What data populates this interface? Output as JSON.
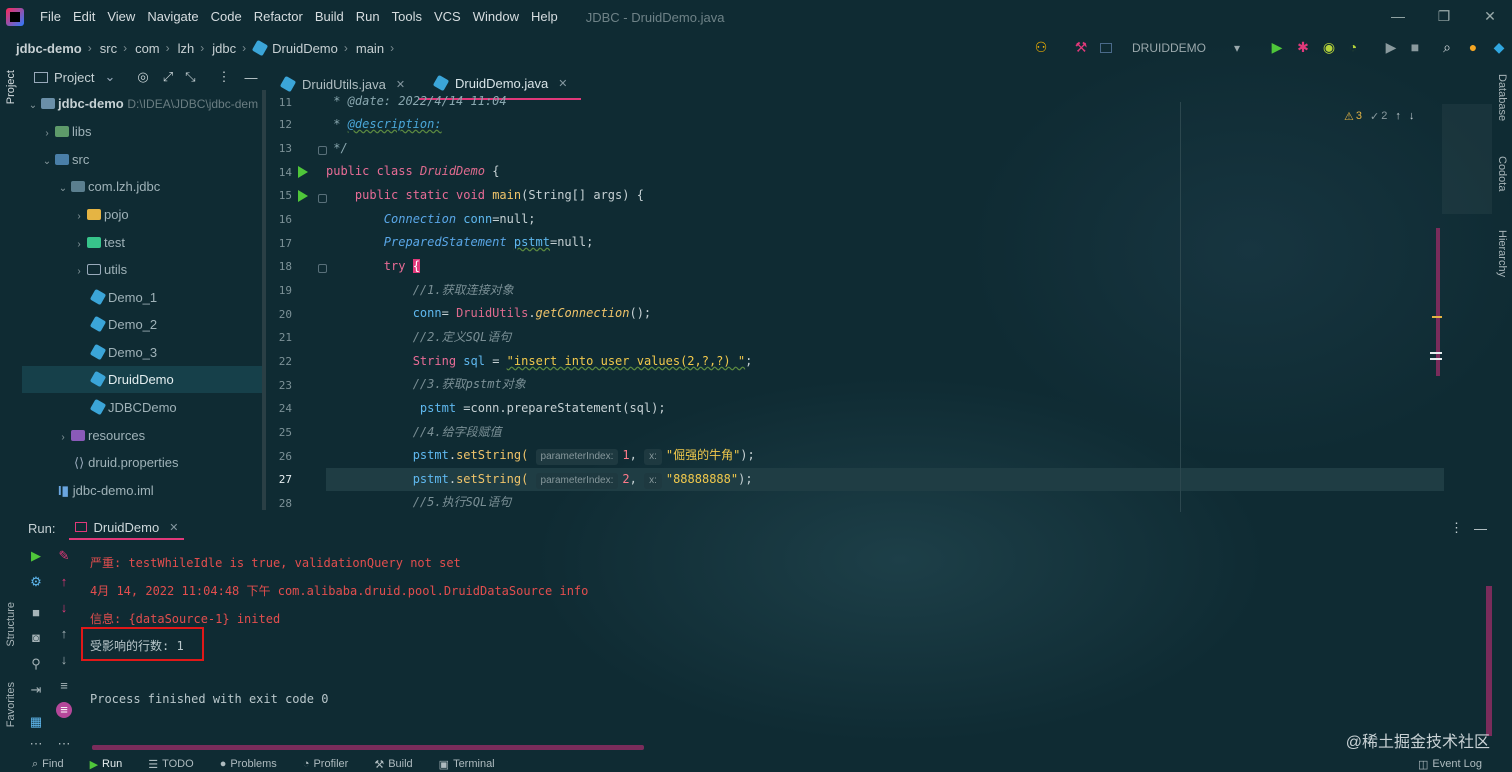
{
  "menu": [
    "File",
    "Edit",
    "View",
    "Navigate",
    "Code",
    "Refactor",
    "Build",
    "Run",
    "Tools",
    "VCS",
    "Window",
    "Help"
  ],
  "window_title": "JDBC - DruidDemo.java",
  "breadcrumb": [
    "jdbc-demo",
    "src",
    "com",
    "lzh",
    "jdbc",
    "DruidDemo",
    "main"
  ],
  "run_config": "DRUIDDEMO",
  "project_panel": {
    "title": "Project",
    "root_name": "jdbc-demo",
    "root_path": "D:\\IDEA\\JDBC\\jdbc-dem",
    "items": [
      "libs",
      "src",
      "com.lzh.jdbc",
      "pojo",
      "test",
      "utils",
      "Demo_1",
      "Demo_2",
      "Demo_3",
      "DruidDemo",
      "JDBCDemo",
      "resources",
      "druid.properties",
      "jdbc-demo.iml"
    ]
  },
  "editor": {
    "tabs": [
      "DruidUtils.java",
      "DruidDemo.java"
    ],
    "active_tab": "DruidDemo.java",
    "line_numbers": [
      "11",
      "12",
      "13",
      "14",
      "15",
      "16",
      "17",
      "18",
      "19",
      "20",
      "21",
      "22",
      "23",
      "24",
      "25",
      "26",
      "27",
      "28"
    ],
    "current_line": "27",
    "code": {
      "l11": " * @date: 2022/4/14 11:04",
      "l12_tag": "@description:",
      "l13": " */",
      "l14_kw": "public class",
      "l14_cls": "DruidDemo",
      "l15_kw": "public static void",
      "l15_fn": "main",
      "l15_rest": "(String[] args) {",
      "l16_ty": "Connection",
      "l16_var": "conn",
      "l16_rest": "=null;",
      "l17_ty": "PreparedStatement",
      "l17_var": "pstmt",
      "l17_rest": "=null;",
      "l18_kw": "try",
      "l19": "//1.获取连接对象",
      "l20_var": "conn",
      "l20_cls": "DruidUtils",
      "l20_fn": "getConnection",
      "l21": "//2.定义SQL语句",
      "l22_ty": "String",
      "l22_var": "sql",
      "l22_str": "\"insert into user values(2,?,?) \"",
      "l23": "//3.获取pstmt对象",
      "l24_var": "pstmt",
      "l24_rest": "=conn.prepareStatement(sql);",
      "l25": "//4.给字段赋值",
      "l26_var": "pstmt",
      "l26_fn": "setString(",
      "l26_hint1": "parameterIndex:",
      "l26_num": "1",
      "l26_hint2": "x:",
      "l26_str": "\"倔强的牛角\"",
      "l27_var": "pstmt",
      "l27_fn": "setString(",
      "l27_hint1": "parameterIndex:",
      "l27_num": "2",
      "l27_hint2": "x:",
      "l27_str": "\"88888888\"",
      "l28": "//5.执行SQL语句"
    },
    "warnings": "3",
    "weak_warnings": "2"
  },
  "run_panel": {
    "label": "Run:",
    "tab": "DruidDemo",
    "lines": [
      "严重: testWhileIdle is true, validationQuery not set",
      "4月 14, 2022 11:04:48 下午 com.alibaba.druid.pool.DruidDataSource info",
      "信息: {dataSource-1} inited",
      "受影响的行数: 1",
      "",
      "Process finished with exit code 0"
    ]
  },
  "side_tabs": {
    "left": [
      "Project",
      "Structure",
      "Favorites"
    ],
    "right": [
      "Database",
      "Codota",
      "Hierarchy"
    ]
  },
  "status_bar": [
    "Find",
    "Run",
    "TODO",
    "Problems",
    "Profiler",
    "Build",
    "Terminal",
    "Event Log"
  ],
  "watermark": "@稀土掘金技术社区",
  "colors": {
    "accent": "#e0397a",
    "highlight_box": "#e01818",
    "background": "#0f2b33"
  }
}
